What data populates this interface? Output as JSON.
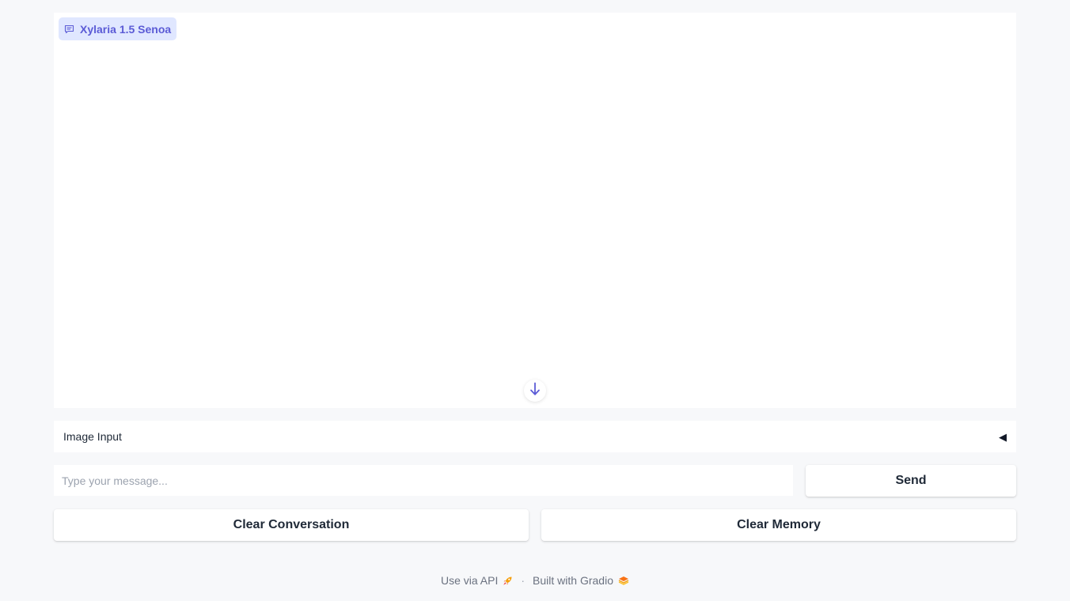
{
  "chatbot": {
    "label": "Xylaria 1.5 Senoa",
    "label_icon": "chat-bubble-icon",
    "scroll_icon": "arrow-down-icon"
  },
  "image_input": {
    "label": "Image Input",
    "caret": "◀"
  },
  "message_input": {
    "placeholder": "Type your message...",
    "value": ""
  },
  "buttons": {
    "send": "Send",
    "clear_conversation": "Clear Conversation",
    "clear_memory": "Clear Memory"
  },
  "footer": {
    "api_link": "Use via API",
    "separator": "·",
    "built_with": "Built with Gradio",
    "api_icon": "rocket-icon",
    "gradio_icon": "gradio-logo-icon"
  },
  "colors": {
    "accent": "#5b5bd6",
    "label_bg": "#e0e7ff",
    "page_bg": "#f7f8fa"
  }
}
